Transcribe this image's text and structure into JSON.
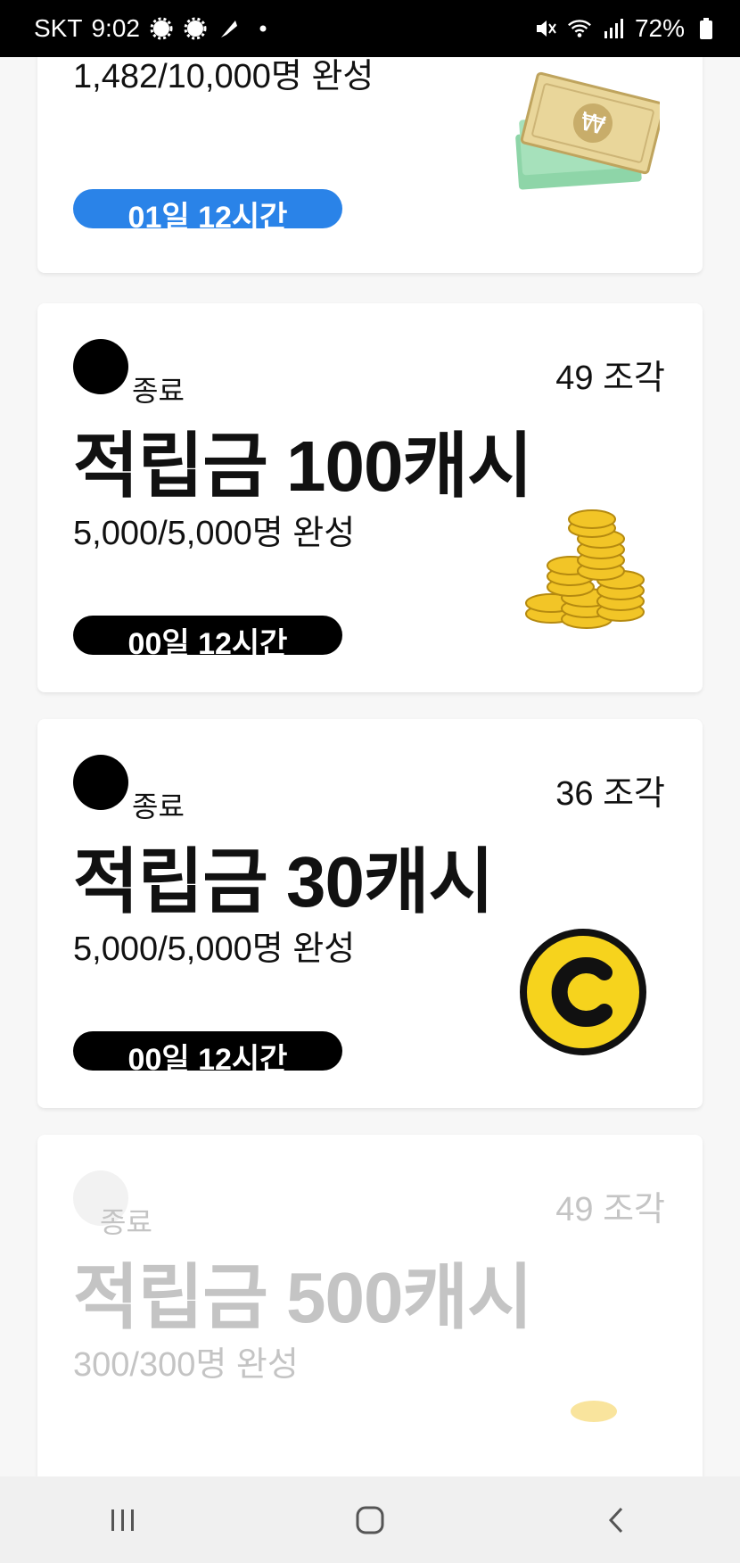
{
  "status_bar": {
    "carrier": "SKT",
    "time": "9:02",
    "battery": "72%",
    "icons": [
      "gear-icon",
      "gear-icon",
      "feather-icon",
      "dot-icon",
      "mute-icon",
      "wifi-icon",
      "signal-icon",
      "battery-icon"
    ]
  },
  "cards": [
    {
      "progress": "1,482/10,000명 완성",
      "timer": "01일 12시간",
      "timer_color": "#2a83e8",
      "image": "banknote-icon"
    },
    {
      "status": "종료",
      "pieces": "49 조각",
      "title": "적립금 100캐시",
      "progress": "5,000/5,000명 완성",
      "timer": "00일 12시간",
      "image": "coin-stack-icon"
    },
    {
      "status": "종료",
      "pieces": "36 조각",
      "title": "적립금 30캐시",
      "progress": "5,000/5,000명 완성",
      "timer": "00일 12시간",
      "image": "cash-coin-icon"
    },
    {
      "status": "종료",
      "pieces": "49 조각",
      "title": "적립금 500캐시",
      "progress": "300/300명 완성",
      "image": "coin-stack-icon"
    }
  ],
  "nav": [
    "recent-apps-icon",
    "home-icon",
    "back-icon"
  ],
  "colors": {
    "accent_blue": "#2a83e8",
    "coin_yellow": "#f6d31d",
    "faded_text": "#c4c4c4"
  }
}
